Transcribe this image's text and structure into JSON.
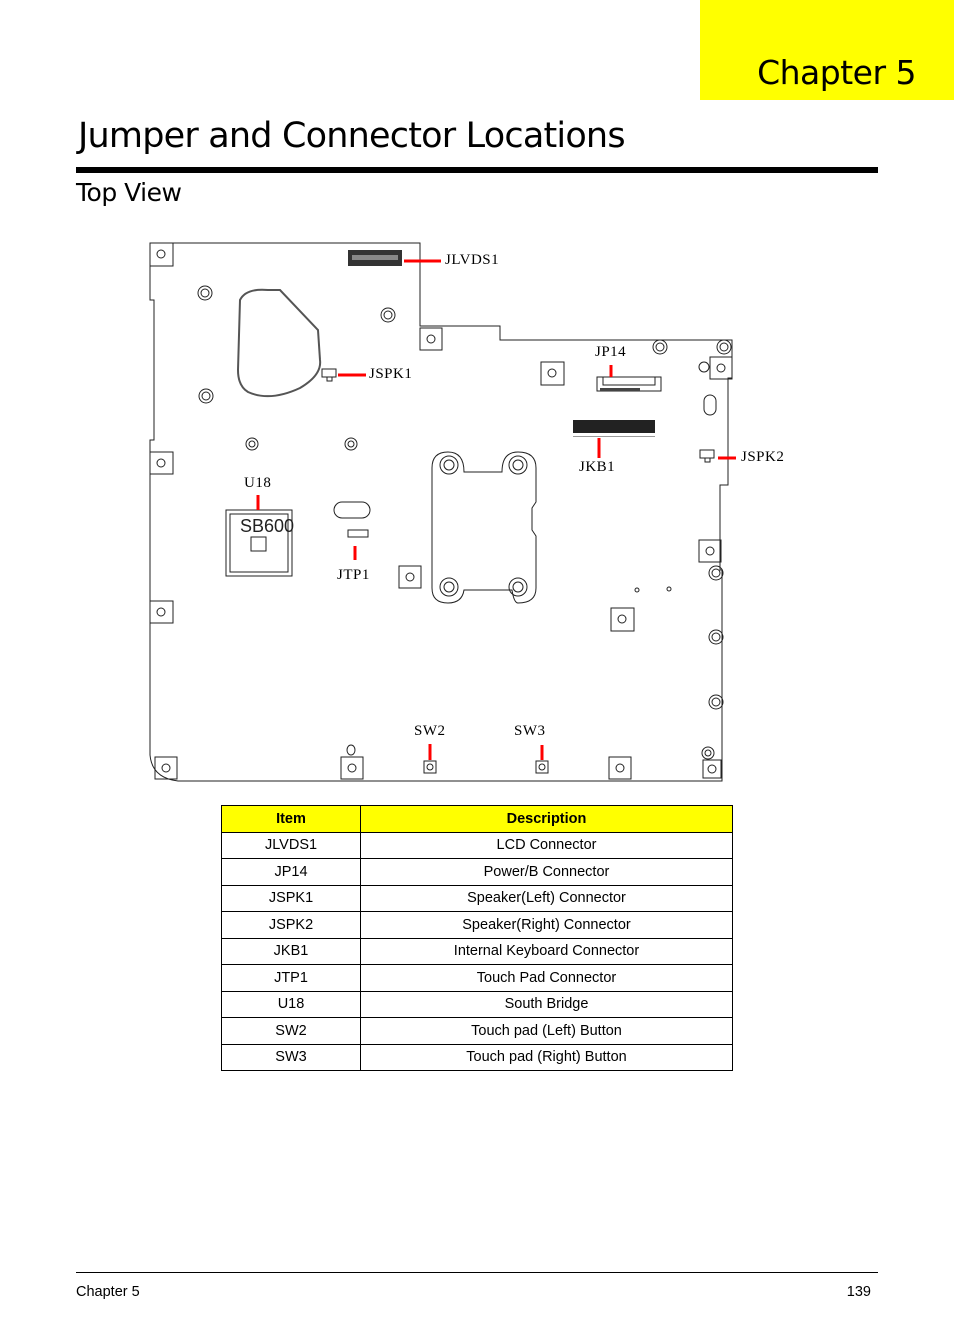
{
  "header": {
    "chapter_tab": "Chapter 5",
    "page_title": "Jumper and Connector Locations",
    "section_title": "Top View"
  },
  "diagram": {
    "callouts": {
      "jlvds1": "JLVDS1",
      "jspk1": "JSPK1",
      "jp14": "JP14",
      "jkb1": "JKB1",
      "jspk2": "JSPK2",
      "u18": "U18",
      "jtp1": "JTP1",
      "sw2": "SW2",
      "sw3": "SW3"
    },
    "chip_marking": "SB600",
    "callout_color": "#ff0000"
  },
  "table": {
    "headers": [
      "Item",
      "Description"
    ],
    "rows": [
      {
        "item": "JLVDS1",
        "description": "LCD Connector"
      },
      {
        "item": "JP14",
        "description": "Power/B Connector"
      },
      {
        "item": "JSPK1",
        "description": "Speaker(Left) Connector"
      },
      {
        "item": "JSPK2",
        "description": "Speaker(Right) Connector"
      },
      {
        "item": "JKB1",
        "description": "Internal Keyboard Connector"
      },
      {
        "item": "JTP1",
        "description": "Touch Pad Connector"
      },
      {
        "item": "U18",
        "description": "South Bridge"
      },
      {
        "item": "SW2",
        "description": "Touch pad (Left) Button"
      },
      {
        "item": "SW3",
        "description": "Touch pad (Right) Button"
      }
    ],
    "header_color": "#ffff00"
  },
  "footer": {
    "chapter": "Chapter 5",
    "page_number": "139"
  }
}
